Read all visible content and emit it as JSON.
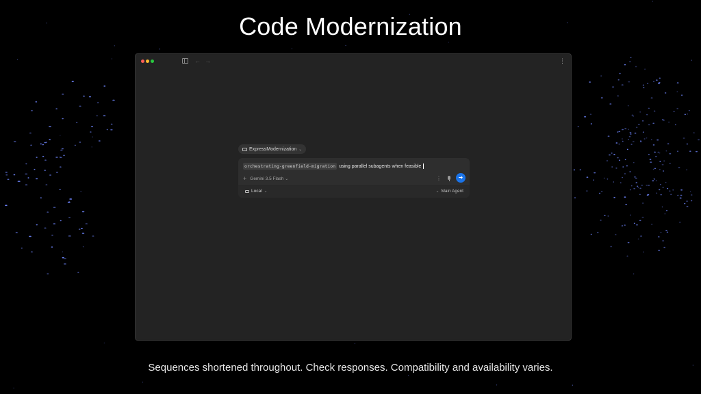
{
  "slide": {
    "title": "Code Modernization",
    "disclaimer": "Sequences shortened throughout. Check responses. Compatibility and availability varies."
  },
  "window": {
    "icons": {
      "sidebar_toggle": "sidebar-toggle-icon",
      "back": "←",
      "forward": "→",
      "more": "⋮"
    }
  },
  "workspace": {
    "name": "ExpressModernization"
  },
  "prompt": {
    "command_chip": "orchestrating-greenfield-migration",
    "text": "using parallel subagents when feasible"
  },
  "controls": {
    "add": "+",
    "model": "Gemini 3.5 Flash",
    "more": "⋮",
    "send": "➜",
    "send_color": "#1a73e8"
  },
  "footer": {
    "environment": "Local",
    "agent": "Main Agent"
  }
}
